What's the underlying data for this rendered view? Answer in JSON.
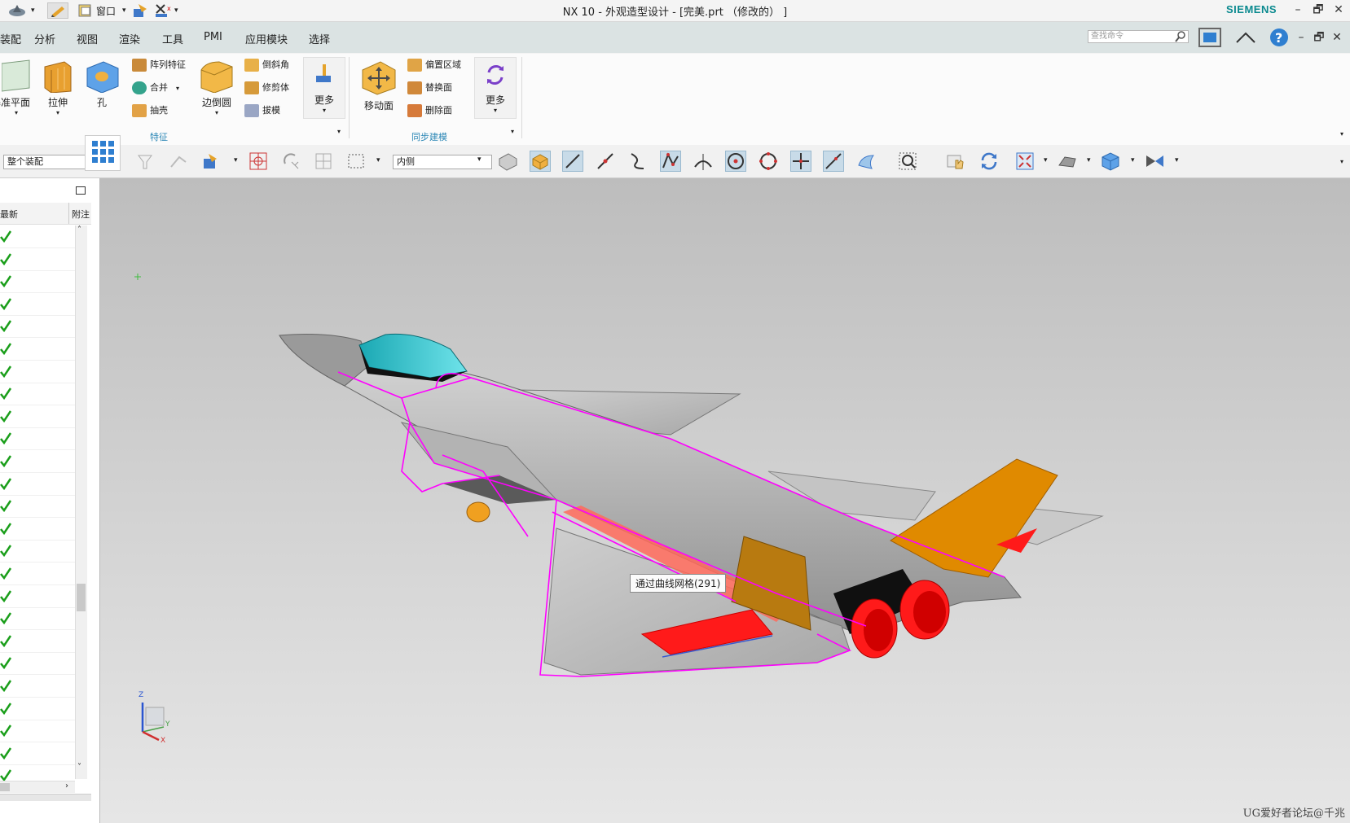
{
  "window": {
    "title": "NX 10 - 外观造型设计 - [完美.prt （修改的） ]",
    "brand": "SIEMENS",
    "quick_access_window_label": "窗口",
    "controls": [
      "–",
      "🗗",
      "✕"
    ]
  },
  "menu": {
    "items": [
      "装配",
      "分析",
      "视图",
      "渲染",
      "工具",
      "PMI",
      "应用模块",
      "选择"
    ],
    "search_placeholder": "查找命令"
  },
  "ribbon": {
    "feature_group": {
      "label": "特征",
      "big_buttons": [
        "基准平面",
        "拉伸",
        "孔",
        "边倒圆"
      ],
      "small_buttons": [
        "阵列特征",
        "合并",
        "抽壳",
        "倒斜角",
        "修剪体",
        "拔模"
      ],
      "more": "更多"
    },
    "sync_group": {
      "label": "同步建模",
      "big_buttons": [
        "移动面"
      ],
      "small_buttons": [
        "偏置区域",
        "替换面",
        "删除面"
      ],
      "more": "更多"
    }
  },
  "toolbar": {
    "filter_value": "整个装配",
    "selection_mode": "内侧"
  },
  "navigator": {
    "col_latest": "最新",
    "col_note": "附注",
    "row_count": 25
  },
  "viewport": {
    "tooltip": "通过曲线网格(291)",
    "triad": {
      "z": "Z",
      "y": "Y",
      "x": "X"
    },
    "watermark": "UG爱好者论坛@千兆"
  },
  "colors": {
    "accent_teal": "#0b8a8f",
    "menu_bg": "#dbe3e3",
    "selection_magenta": "#ff00ff",
    "fin_orange": "#e08a00",
    "nozzle_red": "#ff1a1a",
    "canopy_cyan": "#2fc8d0",
    "check_green": "#1a9e1a"
  }
}
